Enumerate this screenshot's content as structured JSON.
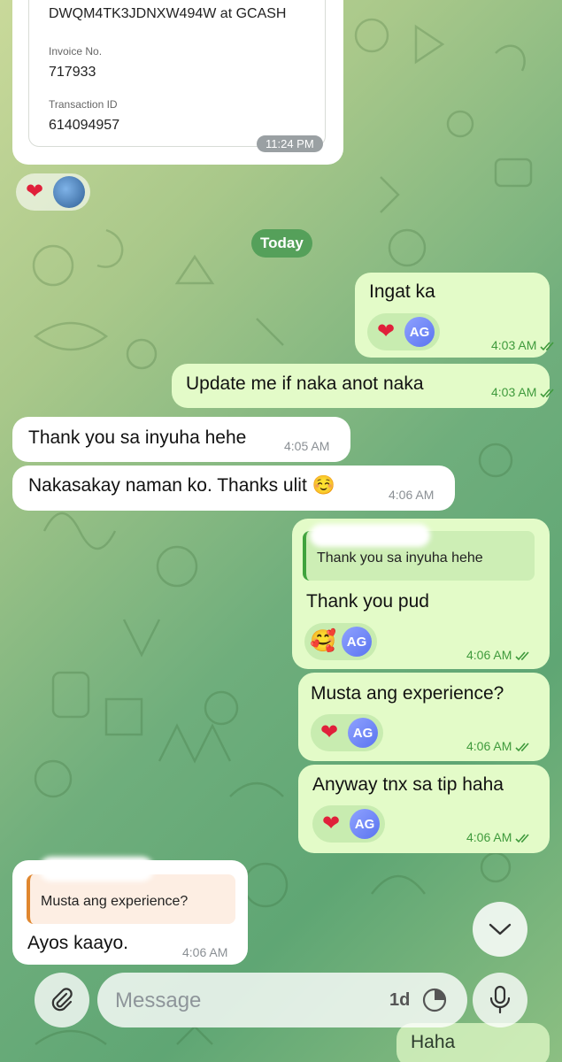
{
  "header_card": {
    "reference": "DWQM4TK3JDNXW494W at GCASH",
    "invoice_label": "Invoice No.",
    "invoice_value": "717933",
    "transaction_label": "Transaction ID",
    "transaction_value": "614094957",
    "time": "11:24 PM"
  },
  "date_separator": "Today",
  "reaction_avatar_initials": "AG",
  "messages": [
    {
      "direction": "out",
      "text": "Ingat ka",
      "time": "4:03 AM",
      "reactions": [
        "heart"
      ]
    },
    {
      "direction": "out",
      "text": "Update me if naka anot naka",
      "time": "4:03 AM"
    },
    {
      "direction": "in",
      "text": "Thank you sa inyuha hehe",
      "time": "4:05 AM"
    },
    {
      "direction": "in",
      "text": "Nakasakay naman ko. Thanks ulit ☺️",
      "time": "4:06 AM"
    },
    {
      "direction": "out",
      "reply_to": "Thank you sa inyuha hehe",
      "text": "Thank you pud",
      "time": "4:06 AM",
      "reactions": [
        "smiling-hearts"
      ]
    },
    {
      "direction": "out",
      "text": "Musta ang experience?",
      "time": "4:06 AM",
      "reactions": [
        "heart"
      ]
    },
    {
      "direction": "out",
      "text": "Anyway tnx sa tip haha",
      "time": "4:06 AM",
      "reactions": [
        "heart"
      ]
    },
    {
      "direction": "in",
      "reply_to": "Musta ang experience?",
      "text": "Ayos kaayo.",
      "time": "4:06 AM"
    },
    {
      "direction": "out",
      "text": "Haha",
      "time": ""
    }
  ],
  "input": {
    "placeholder": "Message",
    "timer_label": "1d"
  },
  "colors": {
    "outgoing_bubble": "#e3fbc8",
    "incoming_bubble": "#ffffff",
    "accent_green": "#3f9a3c",
    "heart": "#e0203a"
  },
  "icons": [
    "paperclip-icon",
    "clock-icon",
    "microphone-icon",
    "chevron-down-icon",
    "double-check-icon",
    "heart-icon"
  ]
}
